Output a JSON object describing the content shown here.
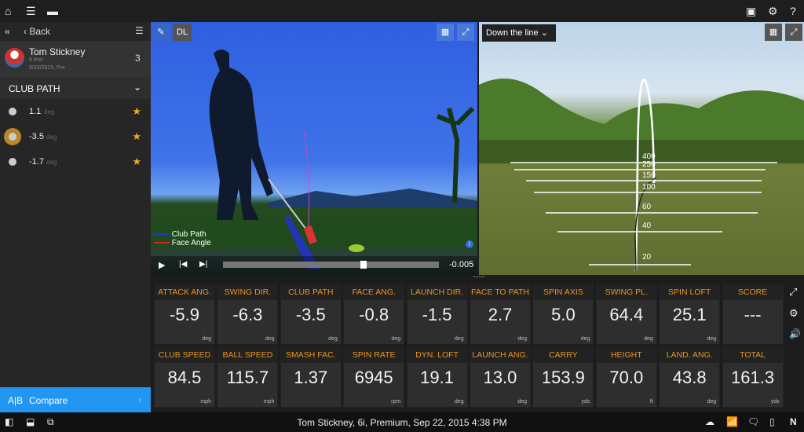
{
  "topbar": {
    "icons": [
      "home-icon",
      "list-icon",
      "folder-icon",
      "notes-icon",
      "gear-icon",
      "help-icon"
    ],
    "help": "?"
  },
  "sidebar": {
    "collapse": "«",
    "back": "‹ Back",
    "player": {
      "name": "Tom Stickney",
      "club": "6 Iron",
      "session": "9/22/2015, Pre",
      "count": "3"
    },
    "section": "CLUB PATH",
    "items": [
      {
        "value": "1.1",
        "unit": "deg",
        "selected": false
      },
      {
        "value": "-3.5",
        "unit": "deg",
        "selected": true
      },
      {
        "value": "-1.7",
        "unit": "deg",
        "selected": false
      }
    ],
    "compare": {
      "icon": "A|B",
      "label": "Compare"
    }
  },
  "video": {
    "dl": "DL",
    "legend": [
      "Club Path",
      "Face Angle"
    ],
    "legend_colors": [
      "#2233cc",
      "#dd2222"
    ],
    "time": "-0.005",
    "scrub_progress": 0.65
  },
  "view3d": {
    "dropdown": "Down the line",
    "yardages": [
      "400",
      "250",
      "150",
      "100",
      "60",
      "40",
      "20"
    ]
  },
  "metrics": [
    {
      "label": "ATTACK ANG.",
      "value": "-5.9",
      "unit": "deg"
    },
    {
      "label": "SWING DIR.",
      "value": "-6.3",
      "unit": "deg"
    },
    {
      "label": "CLUB PATH",
      "value": "-3.5",
      "unit": "deg"
    },
    {
      "label": "FACE ANG.",
      "value": "-0.8",
      "unit": "deg"
    },
    {
      "label": "LAUNCH DIR.",
      "value": "-1.5",
      "unit": "deg"
    },
    {
      "label": "FACE TO PATH",
      "value": "2.7",
      "unit": "deg"
    },
    {
      "label": "SPIN AXIS",
      "value": "5.0",
      "unit": "deg"
    },
    {
      "label": "SWING PL.",
      "value": "64.4",
      "unit": "deg"
    },
    {
      "label": "SPIN LOFT",
      "value": "25.1",
      "unit": "deg"
    },
    {
      "label": "SCORE",
      "value": "---",
      "unit": ""
    },
    {
      "label": "CLUB SPEED",
      "value": "84.5",
      "unit": "mph"
    },
    {
      "label": "BALL SPEED",
      "value": "115.7",
      "unit": "mph"
    },
    {
      "label": "SMASH FAC.",
      "value": "1.37",
      "unit": ""
    },
    {
      "label": "SPIN RATE",
      "value": "6945",
      "unit": "rpm"
    },
    {
      "label": "DYN. LOFT",
      "value": "19.1",
      "unit": "deg"
    },
    {
      "label": "LAUNCH ANG.",
      "value": "13.0",
      "unit": "deg"
    },
    {
      "label": "CARRY",
      "value": "153.9",
      "unit": "yds"
    },
    {
      "label": "HEIGHT",
      "value": "70.0",
      "unit": "ft"
    },
    {
      "label": "LAND. ANG.",
      "value": "43.8",
      "unit": "deg"
    },
    {
      "label": "TOTAL",
      "value": "161.3",
      "unit": "yds"
    }
  ],
  "status": {
    "text": "Tom Stickney, 6i, Premium, Sep 22, 2015 4:38 PM",
    "n": "N"
  },
  "colors": {
    "accent": "#e8951f",
    "compare": "#2196f3"
  }
}
